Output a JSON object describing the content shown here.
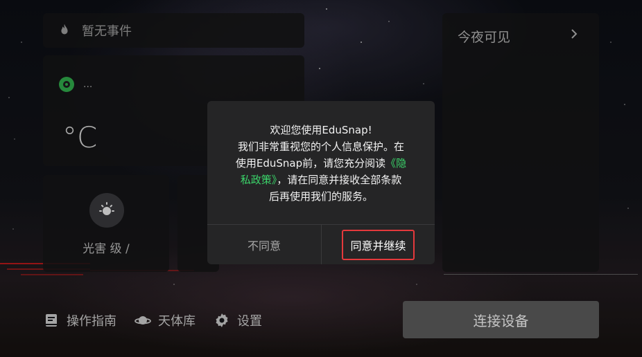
{
  "event_bar": {
    "text": "暂无事件",
    "icon": "flame-icon"
  },
  "weather": {
    "location": "...",
    "temperature": "°C",
    "location_icon": "location-dot-icon"
  },
  "light_pollution": {
    "label": "光害 级 /",
    "icon": "sun-icon"
  },
  "tonight": {
    "title": "今夜可见",
    "icon": "chevron-right-icon"
  },
  "bottom_nav": [
    {
      "label": "操作指南",
      "icon": "book-icon"
    },
    {
      "label": "天体库",
      "icon": "planet-icon"
    },
    {
      "label": "设置",
      "icon": "gear-icon"
    }
  ],
  "connect_button": {
    "label": "连接设备"
  },
  "dialog": {
    "line1": "欢迎您使用EduSnap!",
    "line2": "我们非常重视您的个人信息保护。在",
    "line3_pre": "使用EduSnap前，请您充分阅读",
    "link_part1": "《隐",
    "link_part2": "私政策》",
    "line4_post": "，请在同意并接收全部条款",
    "line5": "后再使用我们的服务。",
    "disagree_label": "不同意",
    "agree_label": "同意并继续"
  },
  "colors": {
    "accent_link": "#3bd46a",
    "highlight_border": "#e5393c",
    "location_dot": "#2fa84a"
  }
}
